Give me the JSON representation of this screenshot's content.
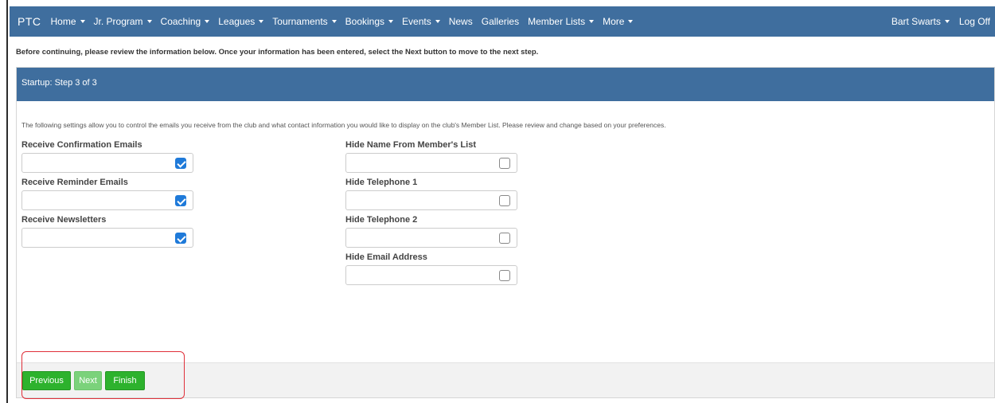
{
  "navbar": {
    "brand": "PTC",
    "items": [
      {
        "label": "Home",
        "dropdown": true
      },
      {
        "label": "Jr. Program",
        "dropdown": true
      },
      {
        "label": "Coaching",
        "dropdown": true
      },
      {
        "label": "Leagues",
        "dropdown": true
      },
      {
        "label": "Tournaments",
        "dropdown": true
      },
      {
        "label": "Bookings",
        "dropdown": true
      },
      {
        "label": "Events",
        "dropdown": true
      },
      {
        "label": "News",
        "dropdown": false
      },
      {
        "label": "Galleries",
        "dropdown": false
      },
      {
        "label": "Member Lists",
        "dropdown": true
      },
      {
        "label": "More",
        "dropdown": true
      }
    ],
    "user": "Bart Swarts",
    "logoff": "Log Off"
  },
  "intro": "Before continuing, please review the information below. Once your information has been entered, select the Next button to move to the next step.",
  "panel": {
    "title": "Startup: Step 3 of 3",
    "description": "The following settings allow you to control the emails you receive from the club and what contact information you would like to display on the club's Member List. Please review and change based on your preferences.",
    "left_fields": [
      {
        "label": "Receive Confirmation Emails",
        "checked": true
      },
      {
        "label": "Receive Reminder Emails",
        "checked": true
      },
      {
        "label": "Receive Newsletters",
        "checked": true
      }
    ],
    "right_fields": [
      {
        "label": "Hide Name From Member's List",
        "checked": false
      },
      {
        "label": "Hide Telephone 1",
        "checked": false
      },
      {
        "label": "Hide Telephone 2",
        "checked": false
      },
      {
        "label": "Hide Email Address",
        "checked": false
      }
    ],
    "buttons": {
      "previous": "Previous",
      "next": "Next",
      "finish": "Finish"
    }
  },
  "colors": {
    "header_blue": "#3f6e9e",
    "button_green": "#2db22d",
    "button_disabled_green": "#7bd27b",
    "checkbox_blue": "#1f7ad9",
    "highlight_red": "#e0303a"
  }
}
